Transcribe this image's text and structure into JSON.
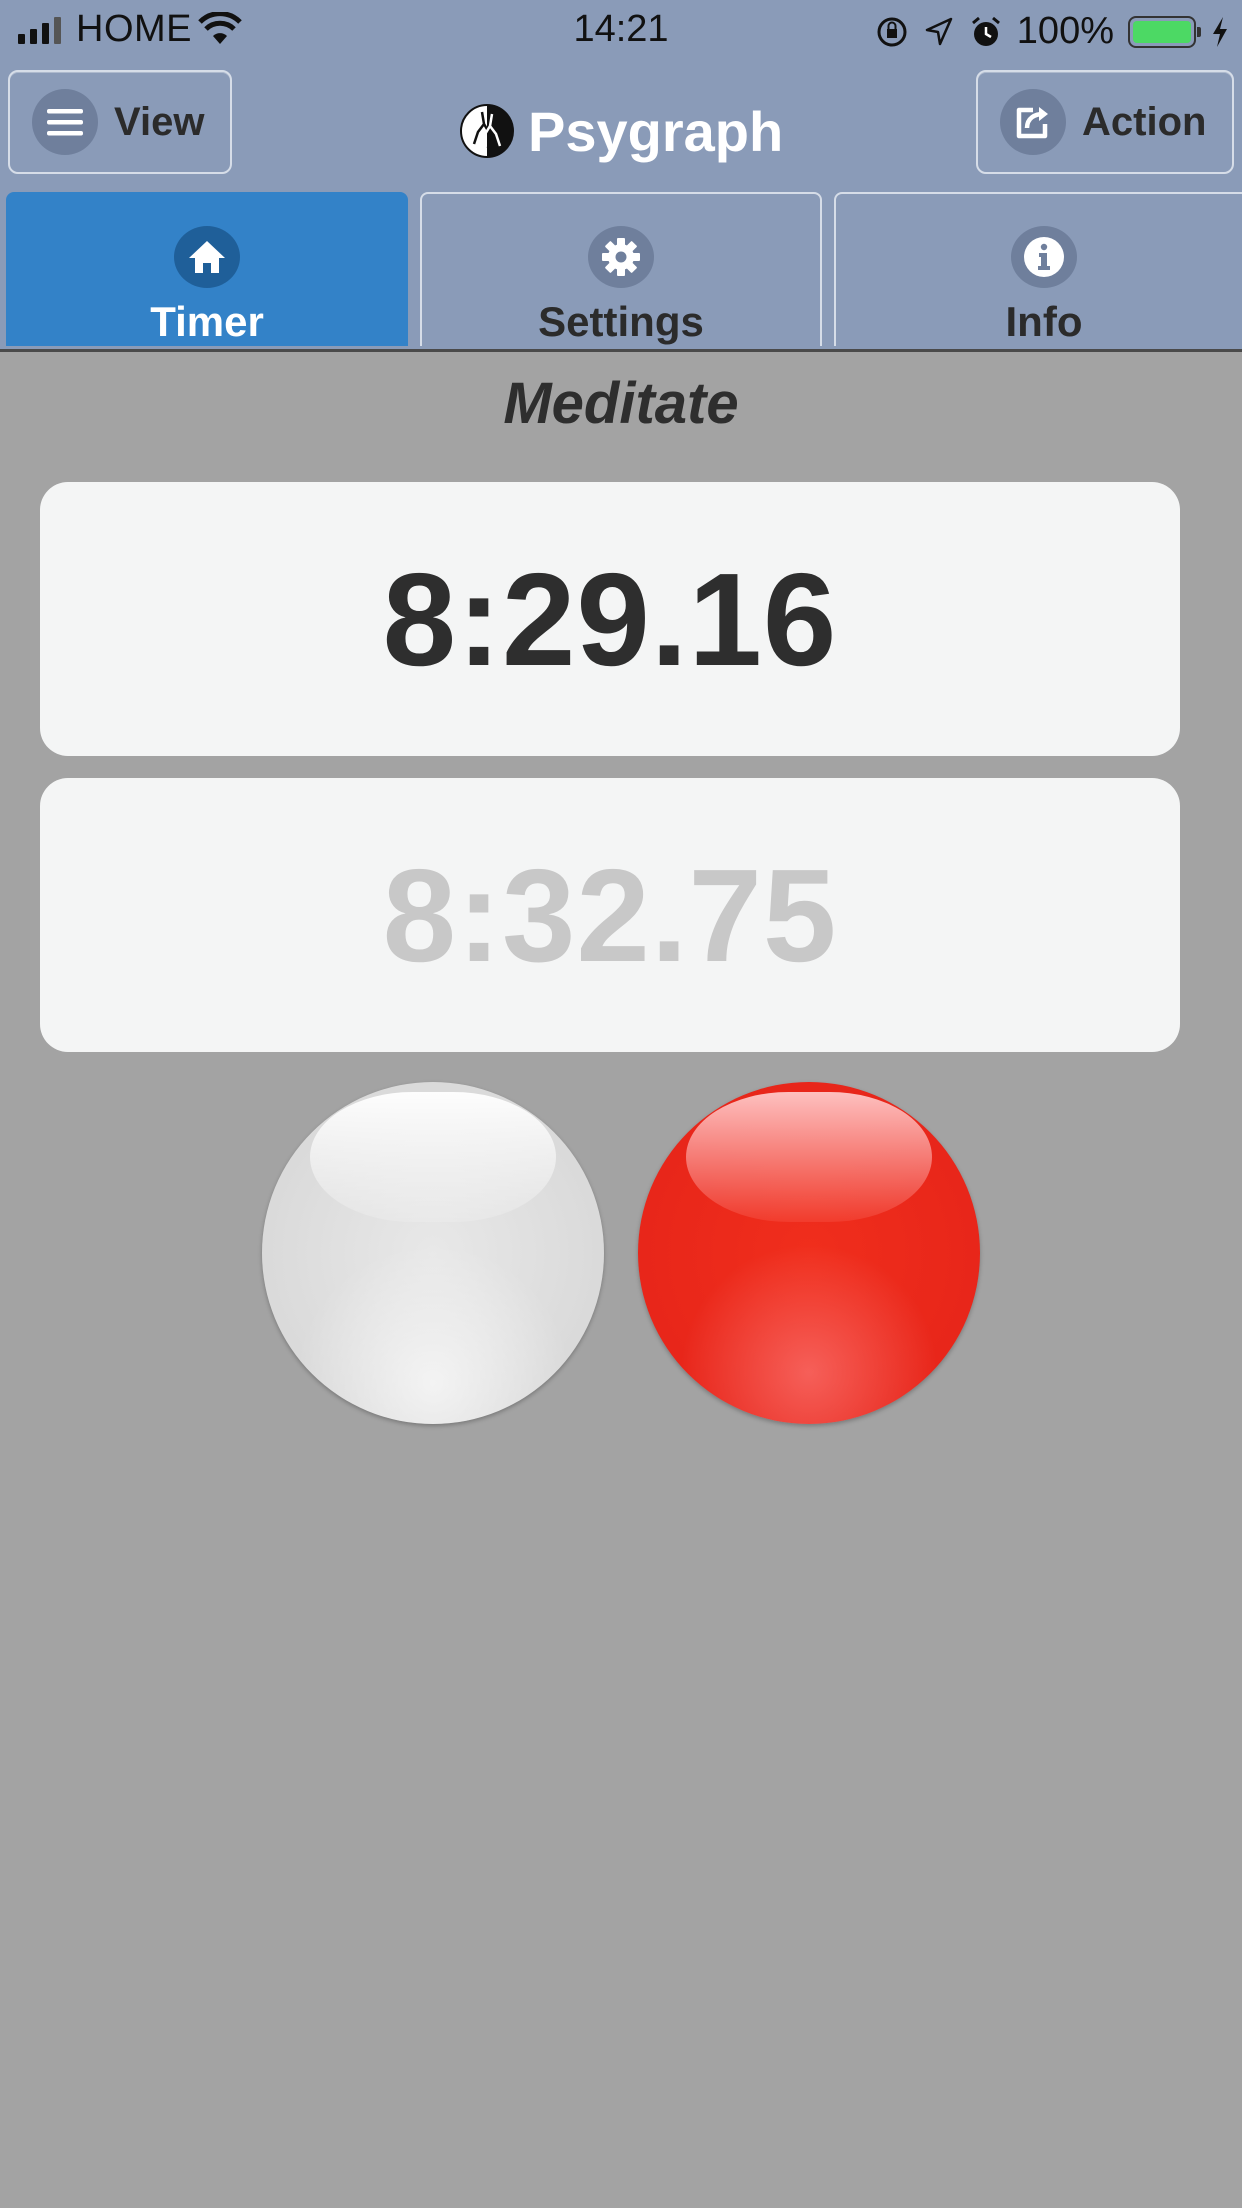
{
  "status_bar": {
    "carrier": "HOME",
    "time": "14:21",
    "battery_percent": "100%",
    "battery_level": 1.0,
    "icons": [
      "signal-icon",
      "wifi-icon",
      "orientation-lock-icon",
      "location-icon",
      "alarm-icon",
      "battery-icon",
      "charging-icon"
    ]
  },
  "header": {
    "title": "Psygraph",
    "view_label": "View",
    "action_label": "Action",
    "icons": {
      "view": "menu-icon",
      "action": "share-icon",
      "logo": "psygraph-logo"
    }
  },
  "tabs": [
    {
      "label": "Timer",
      "icon": "home-icon",
      "active": true
    },
    {
      "label": "Settings",
      "icon": "gear-icon",
      "active": false
    },
    {
      "label": "Info",
      "icon": "info-icon",
      "active": false
    }
  ],
  "main": {
    "mode": "Meditate",
    "current_time": "8:29.16",
    "previous_time": "8:32.75"
  },
  "colors": {
    "chrome": "#8a9bb8",
    "active_tab": "#3382c8",
    "background": "#a3a3a3",
    "stop_button": "#e8261a",
    "start_button": "#d9d9d9"
  }
}
